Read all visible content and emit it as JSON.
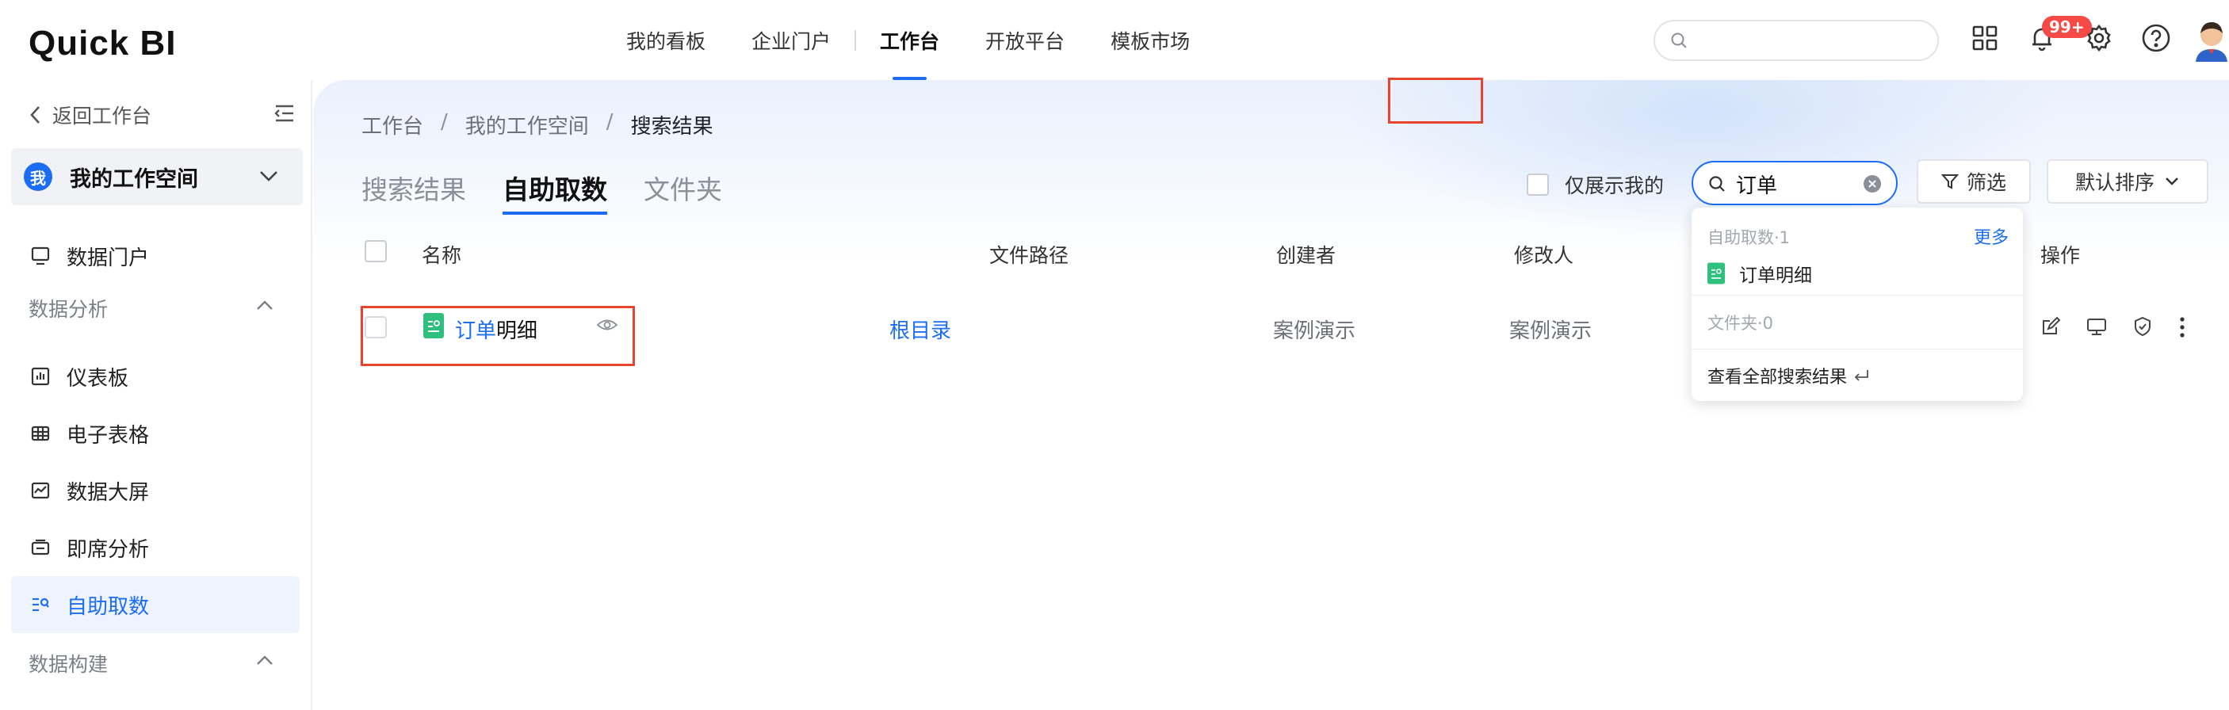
{
  "app": {
    "logo": "Quick BI"
  },
  "topnav": {
    "items": [
      "我的看板",
      "企业门户",
      "工作台",
      "开放平台",
      "模板市场"
    ],
    "active": "工作台"
  },
  "header": {
    "notification_badge": "99+",
    "search_placeholder": ""
  },
  "sidebar": {
    "back_label": "返回工作台",
    "workspace_badge": "我",
    "workspace_label": "我的工作空间",
    "portal_label": "数据门户",
    "group_analysis": "数据分析",
    "items": [
      "仪表板",
      "电子表格",
      "数据大屏",
      "即席分析",
      "自助取数"
    ],
    "active_item": "自助取数",
    "group_build": "数据构建"
  },
  "breadcrumb": {
    "items": [
      "工作台",
      "我的工作空间",
      "搜索结果"
    ],
    "separator": "/"
  },
  "tabs": {
    "items": [
      "搜索结果",
      "自助取数",
      "文件夹"
    ],
    "active": "自助取数"
  },
  "toolbar": {
    "only_mine_label": "仅展示我的",
    "search_value": "订单",
    "filter_label": "筛选",
    "sort_label": "默认排序"
  },
  "table": {
    "columns": [
      "名称",
      "文件路径",
      "创建者",
      "修改人",
      "操作"
    ],
    "rows": [
      {
        "name_highlight": "订单",
        "name_rest": "明细",
        "path": "根目录",
        "creator": "案例演示",
        "modifier": "案例演示"
      }
    ]
  },
  "dropdown": {
    "section_self_service": "自助取数·1",
    "more_label": "更多",
    "result_item": "订单明细",
    "section_folder": "文件夹·0",
    "view_all": "查看全部搜索结果"
  },
  "colors": {
    "accent": "#1b6ef3",
    "highlight_box": "#e8442e",
    "file_icon": "#2fbf7f"
  }
}
